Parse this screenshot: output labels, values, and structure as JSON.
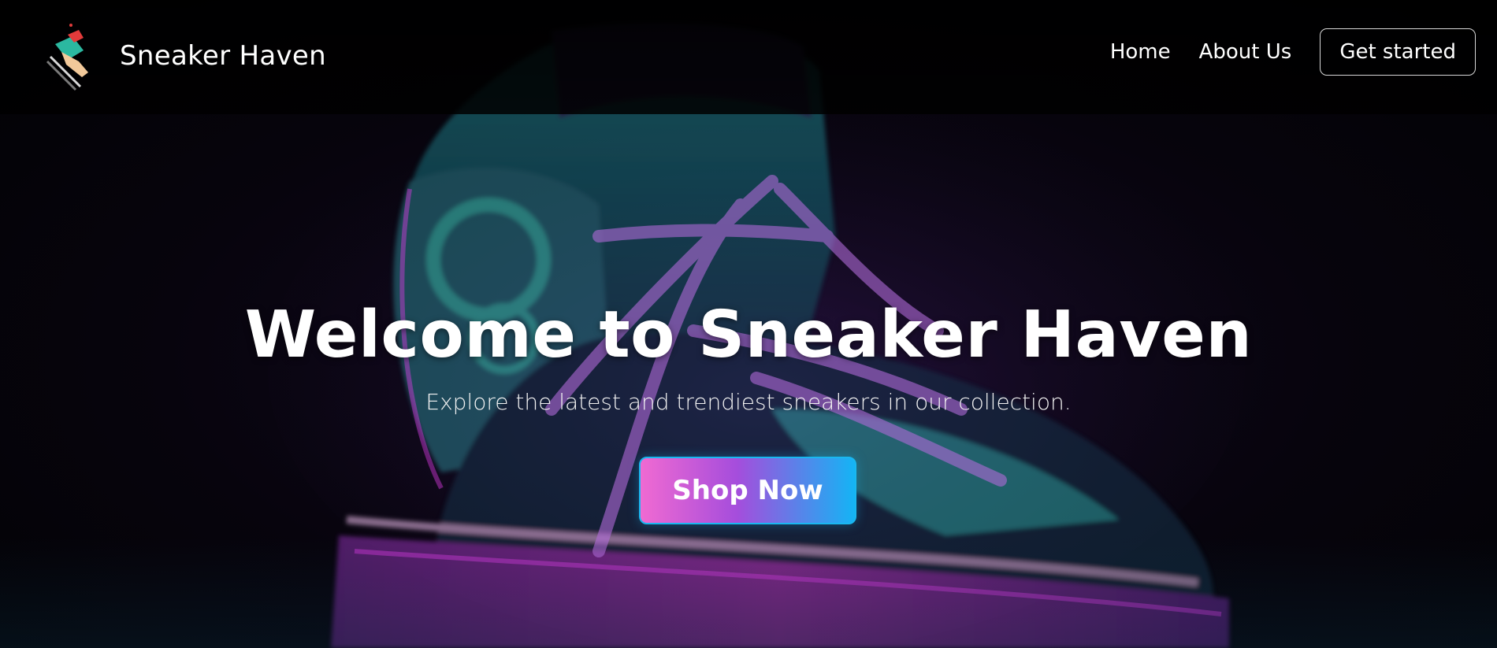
{
  "header": {
    "brand_name": "Sneaker Haven",
    "logo_icon": "sneaker-logo-icon",
    "nav": [
      {
        "label": "Home"
      },
      {
        "label": "About Us"
      }
    ],
    "cta_label": "Get started"
  },
  "hero": {
    "title": "Welcome to Sneaker Haven",
    "subtitle": "Explore the latest and trendiest sneakers in our collection.",
    "button_label": "Shop Now",
    "background_icon": "neon-sneaker-illustration"
  },
  "colors": {
    "background": "#020204",
    "accent_pink": "#f06ad2",
    "accent_purple": "#a54ddc",
    "accent_blue": "#14b4f5",
    "neon_teal": "#2fd6c4",
    "neon_magenta": "#c02ad8"
  }
}
